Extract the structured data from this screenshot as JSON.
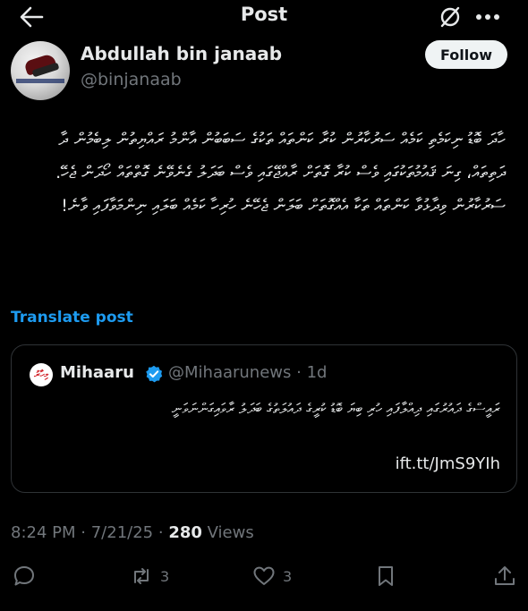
{
  "topbar": {
    "title": "Post"
  },
  "author": {
    "display_name": "Abdullah bin janaab",
    "handle": "@binjanaab",
    "follow_label": "Follow"
  },
  "post": {
    "body": "ހާދަ ބޮޑު ނިކަމެތި ކަމެއް ސަރުކާރުން ކުރާ ކަންތައް ތަކުގެ ސަބަބުން އާންމު ރައްޔިތުން ލިބެމުން ދާ ދަތިތައް، ގިނަ ޤައުމުތަކުގައި ވެސް ކުރާ ގޮތަށް ރާއްޖޭގައި ވެސް ބަދަލު ގެނެވޭނެ ގޮތްތައް ހޯދަން ޖެހޭ. ސަރުކާރުން ވިދާޅުވާ ކަންތައް ތަކާ އެއްގޮތަށް ބަލަން ޖެހޭނެ ހުރިހާ ކަމެއް ބަލައި ނިންމަވާފައި ވާނެ!",
    "translate_label": "Translate post",
    "time": "8:24 PM",
    "date": "7/21/25",
    "views_count": "280",
    "views_label": "Views"
  },
  "quote": {
    "logo_text": "މިހާރު",
    "name": "Mihaaru",
    "handle": "@Mihaarunews",
    "age": "1d",
    "text": "ރައީސްގެ ދައުރުގައި ދިއްލާފައި ހުރި ބިޔަ ބޮޑު ކުރީގެ ދައުލަތުގެ ބަދަލު ރާވައިގަންނަވަނީ",
    "link": "ift.tt/JmS9YIh"
  },
  "actions": {
    "reply_count": "",
    "repost_count": "3",
    "like_count": "3"
  },
  "colors": {
    "accent": "#1d9bf0",
    "muted": "#71767b",
    "text": "#e7e9ea",
    "border": "#2f3336"
  }
}
